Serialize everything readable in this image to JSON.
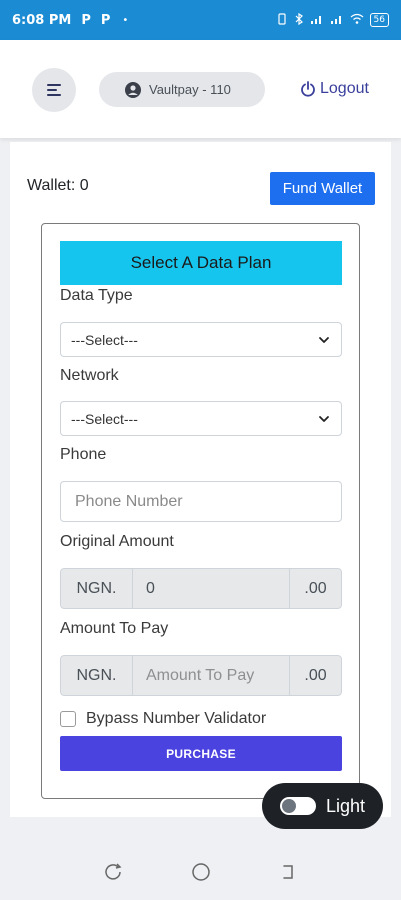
{
  "status_bar": {
    "time": "6:08 PM",
    "app_icons": [
      "P",
      "P"
    ],
    "dot": "•",
    "battery": "56"
  },
  "header": {
    "account_label": "Vaultpay - 110",
    "logout_label": "Logout"
  },
  "wallet": {
    "label": "Wallet: 0",
    "fund_button": "Fund Wallet"
  },
  "form": {
    "title": "Select A Data Plan",
    "data_type": {
      "label": "Data Type",
      "value": "---Select---"
    },
    "network": {
      "label": "Network",
      "value": "---Select---"
    },
    "phone": {
      "label": "Phone",
      "placeholder": "Phone Number"
    },
    "original_amount": {
      "label": "Original Amount",
      "prefix": "NGN.",
      "value": "0",
      "suffix": ".00"
    },
    "amount_to_pay": {
      "label": "Amount To Pay",
      "prefix": "NGN.",
      "placeholder": "Amount To Pay",
      "suffix": ".00"
    },
    "bypass_label": "Bypass Number Validator",
    "purchase_button": "PURCHASE"
  },
  "theme_toggle": {
    "label": "Light"
  },
  "colors": {
    "status_bar": "#1b8bd3",
    "fund_button": "#1d6ff0",
    "plan_banner": "#16c5ee",
    "purchase_button": "#4b43e0",
    "logout": "#3a3f9b"
  }
}
